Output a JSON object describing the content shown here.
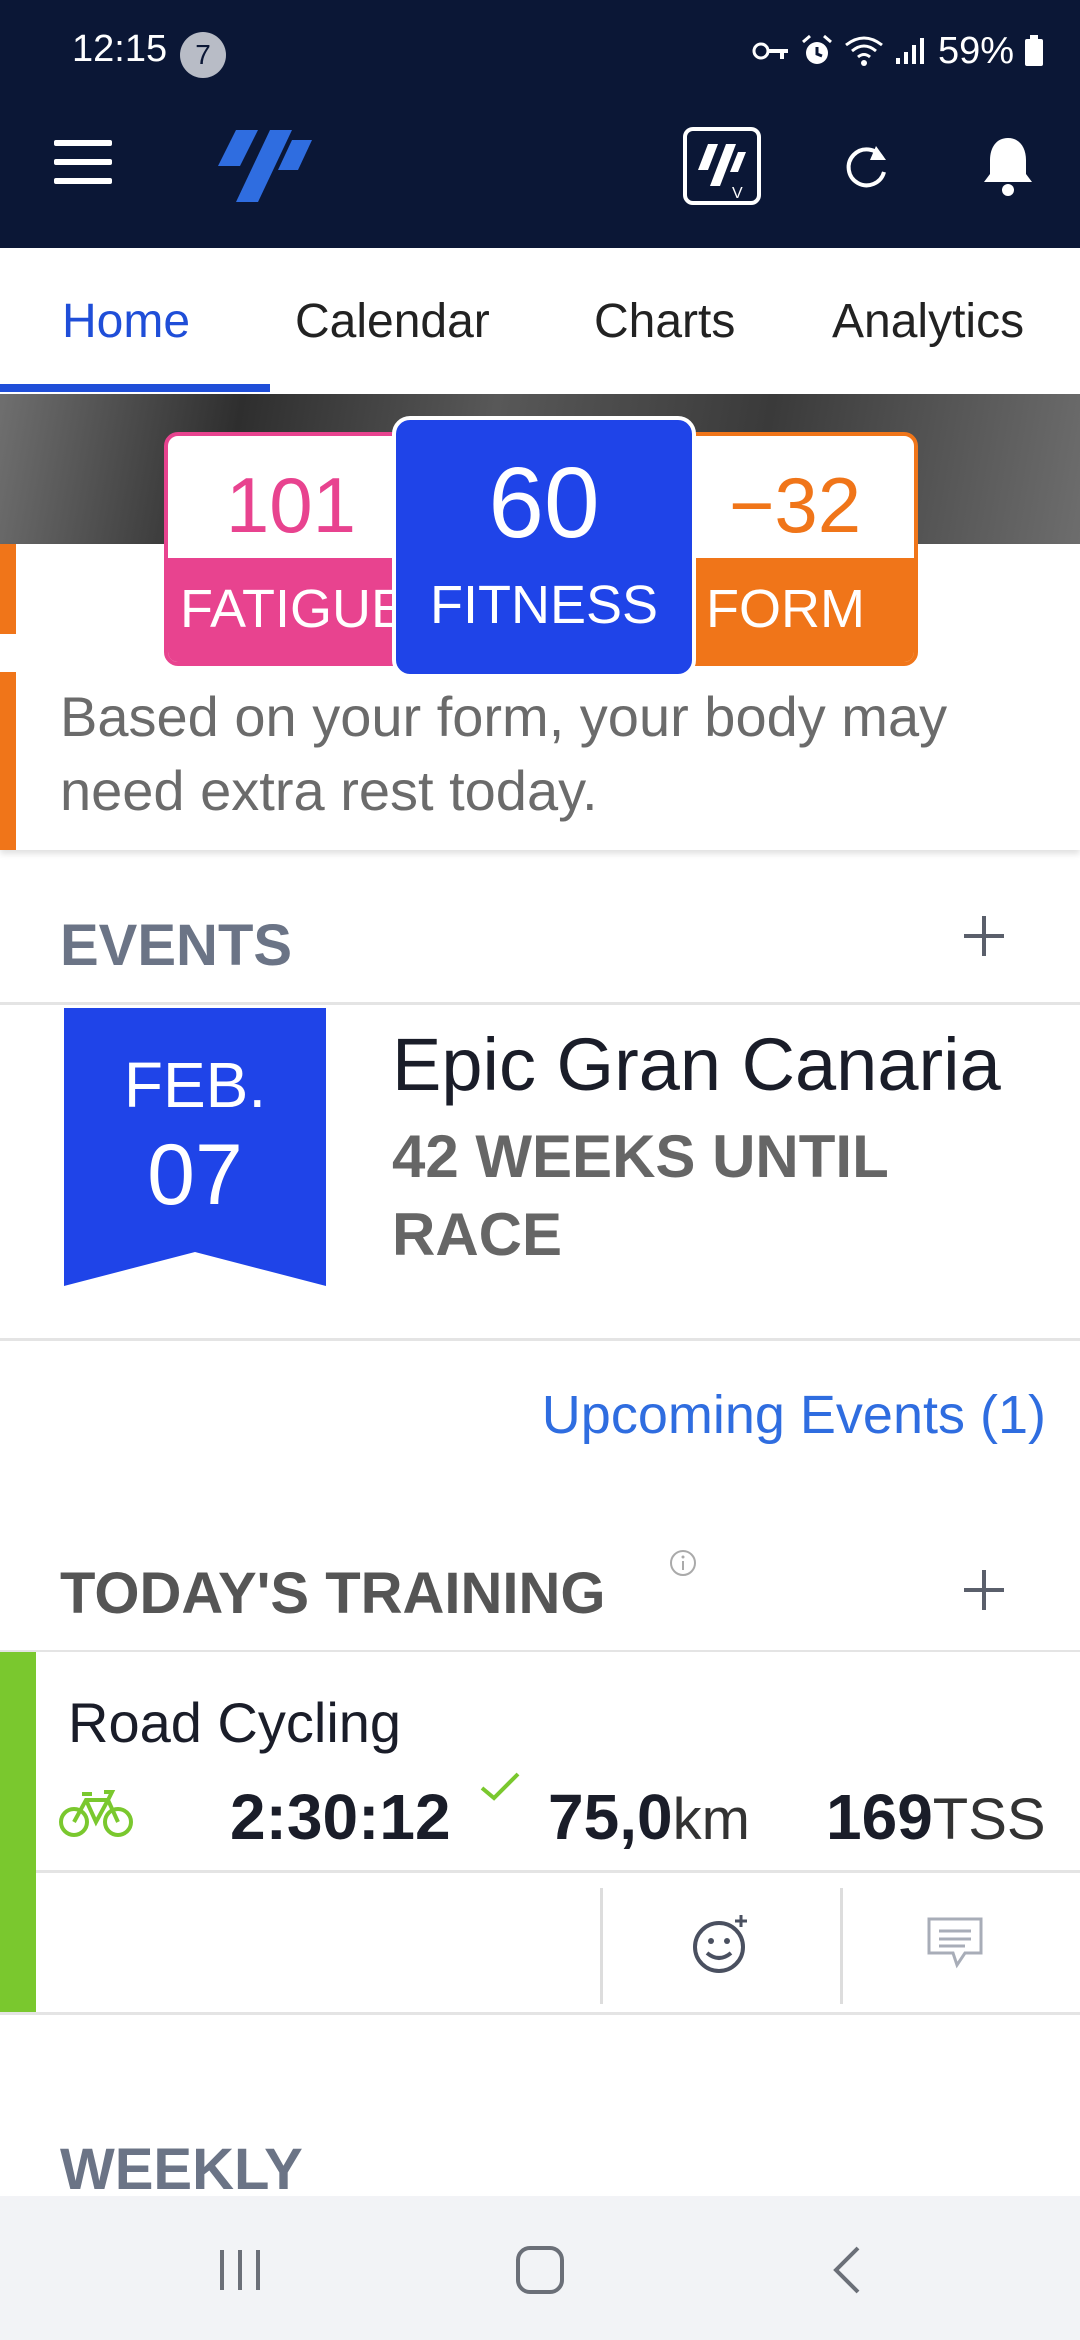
{
  "status_bar": {
    "time": "12:15",
    "notification_count": "7",
    "battery": "59%"
  },
  "app_bar": {
    "icons": [
      "menu-icon",
      "logo-icon",
      "virtual-coach-icon",
      "refresh-icon",
      "bell-icon"
    ]
  },
  "tabs": [
    {
      "label": "Home",
      "active": true
    },
    {
      "label": "Calendar",
      "active": false
    },
    {
      "label": "Charts",
      "active": false
    },
    {
      "label": "Analytics",
      "active": false
    }
  ],
  "metrics": {
    "fatigue": {
      "value": "101",
      "label": "FATIGUE",
      "color": "#e8438f"
    },
    "fitness": {
      "value": "60",
      "label": "FITNESS",
      "color": "#1f44e8"
    },
    "form": {
      "value": "−32",
      "label": "FORM",
      "color": "#f07519"
    }
  },
  "advice": "Based on your form, your body may need extra rest today.",
  "events": {
    "title": "EVENTS",
    "item": {
      "month": "FEB.",
      "day": "07",
      "name": "Epic Gran Canaria",
      "countdown": "42 WEEKS UNTIL RACE"
    },
    "upcoming_link": "Upcoming Events (1)"
  },
  "training": {
    "title": "TODAY'S TRAINING",
    "activity": {
      "name": "Road Cycling",
      "duration": "2:30:12",
      "distance": "75,0",
      "distance_unit": "km",
      "tss": "169",
      "tss_unit": "TSS"
    }
  },
  "weekly": {
    "title": "WEEKLY"
  },
  "colors": {
    "navy": "#0b1736",
    "accent_blue": "#1f4ed8",
    "link_blue": "#2f6de0",
    "green": "#7ac82e"
  }
}
